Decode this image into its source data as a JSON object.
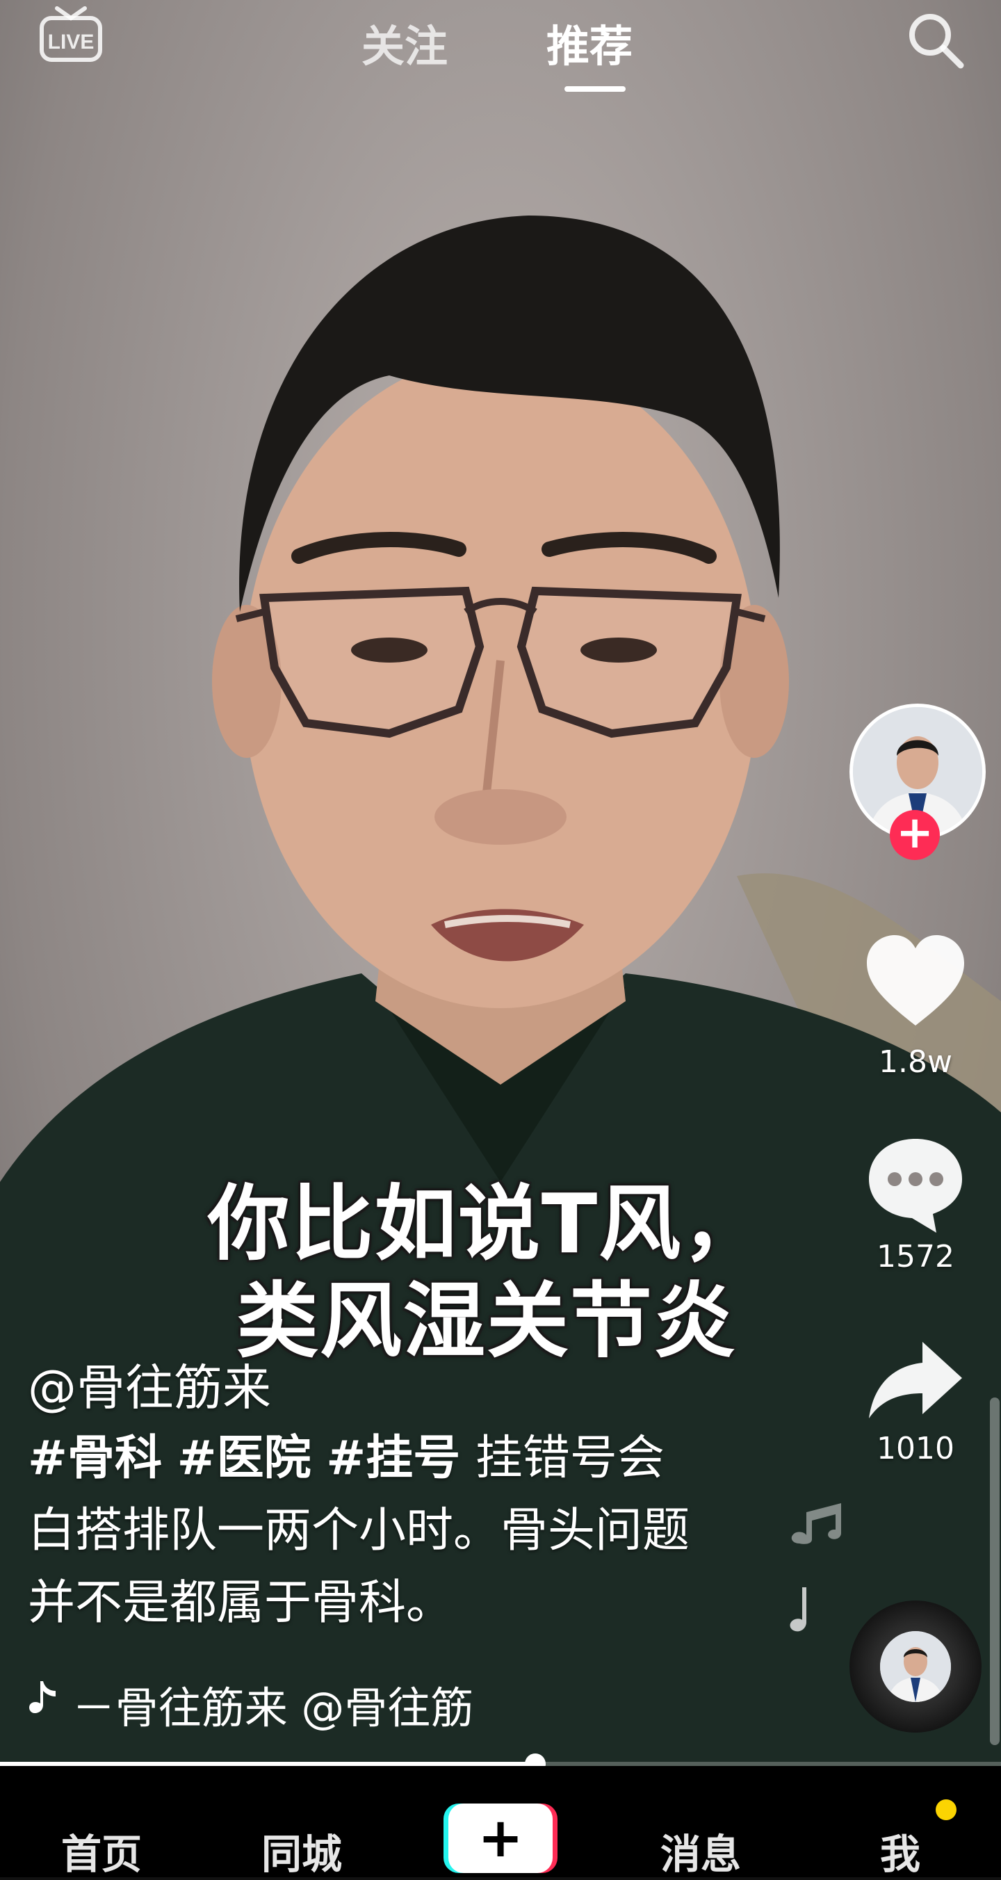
{
  "top_bar": {
    "live_label": "LIVE",
    "tabs": [
      {
        "label": "关注",
        "active": false
      },
      {
        "label": "推荐",
        "active": true
      }
    ]
  },
  "subtitle": {
    "line1": "你比如说T风，",
    "line2": "类风湿关节炎"
  },
  "rail": {
    "likes": "1.8w",
    "comments": "1572",
    "shares": "1010",
    "follow_symbol": "+"
  },
  "post": {
    "author": "@骨往筋来",
    "hashtags": [
      "#骨科",
      "#医院",
      "#挂号"
    ],
    "caption_text": "挂错号会白搭排队一两个小时。骨头问题并不是都属于骨科。",
    "music": "－骨往筋来    @骨往筋"
  },
  "progress": {
    "fraction": 0.535
  },
  "bottom_nav": {
    "items": [
      "首页",
      "同城",
      "消息",
      "我"
    ],
    "create_symbol": "+"
  },
  "colors": {
    "accent_red": "#fe2c55",
    "accent_cyan": "#25f4ee",
    "notification_yellow": "#fbd402"
  }
}
